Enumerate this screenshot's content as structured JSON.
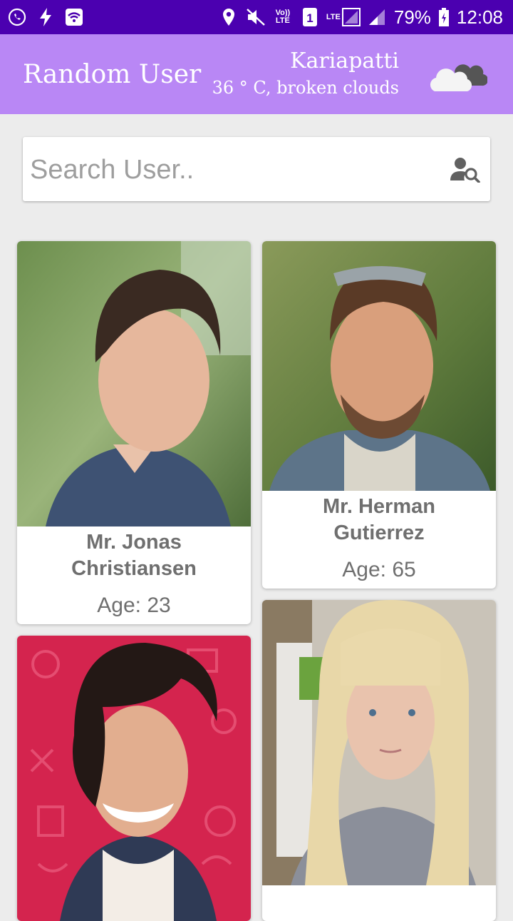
{
  "status_bar": {
    "battery": "79%",
    "time": "12:08",
    "volte_label": "Vo)) LTE",
    "sim_slot": "1",
    "lte_label": "LTE",
    "icons": [
      "whatsapp-icon",
      "flash-icon",
      "wifi-icon",
      "location-icon",
      "mute-icon",
      "volte-icon",
      "sim-1-icon",
      "lte-signal-icon",
      "signal-icon",
      "battery-icon"
    ]
  },
  "app_bar": {
    "title": "Random User",
    "city": "Kariapatti",
    "weather": "36 ° C, broken clouds",
    "weather_icon": "cloud-icon"
  },
  "search": {
    "placeholder": "Search User..",
    "value": "",
    "icon": "user-search-icon"
  },
  "users": [
    {
      "name_line1": "Mr. Jonas",
      "name_line2": "Christiansen",
      "age": "Age: 23"
    },
    {
      "name_line1": "Mr. Herman",
      "name_line2": "Gutierrez",
      "age": "Age: 65"
    },
    {
      "name_line1": "",
      "name_line2": "",
      "age": ""
    },
    {
      "name_line1": "",
      "name_line2": "",
      "age": ""
    }
  ],
  "colors": {
    "status_bar": "#4b00b0",
    "app_bar": "#b987f5",
    "background": "#ececec",
    "text_gray": "#6f6f6f"
  }
}
